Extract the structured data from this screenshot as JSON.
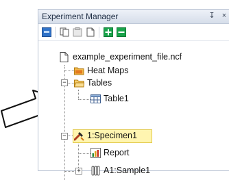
{
  "panel": {
    "title": "Experiment Manager",
    "pin_glyph": "↧",
    "close_glyph": "×"
  },
  "toolbar": {
    "items": [
      "blue-square-icon",
      "copy-icon",
      "paste-icon",
      "new-doc-icon",
      "add-icon",
      "remove-icon"
    ]
  },
  "tree": {
    "file": "example_experiment_file.ncf",
    "heat_maps": "Heat Maps",
    "tables": "Tables",
    "table1": "Table1",
    "specimen": "1:Specimen1",
    "report": "Report",
    "sample": "A1:Sample1"
  },
  "colors": {
    "selection_bg": "#fff5b0",
    "add_green": "#19a34a",
    "marker_red": "#d9352a"
  }
}
